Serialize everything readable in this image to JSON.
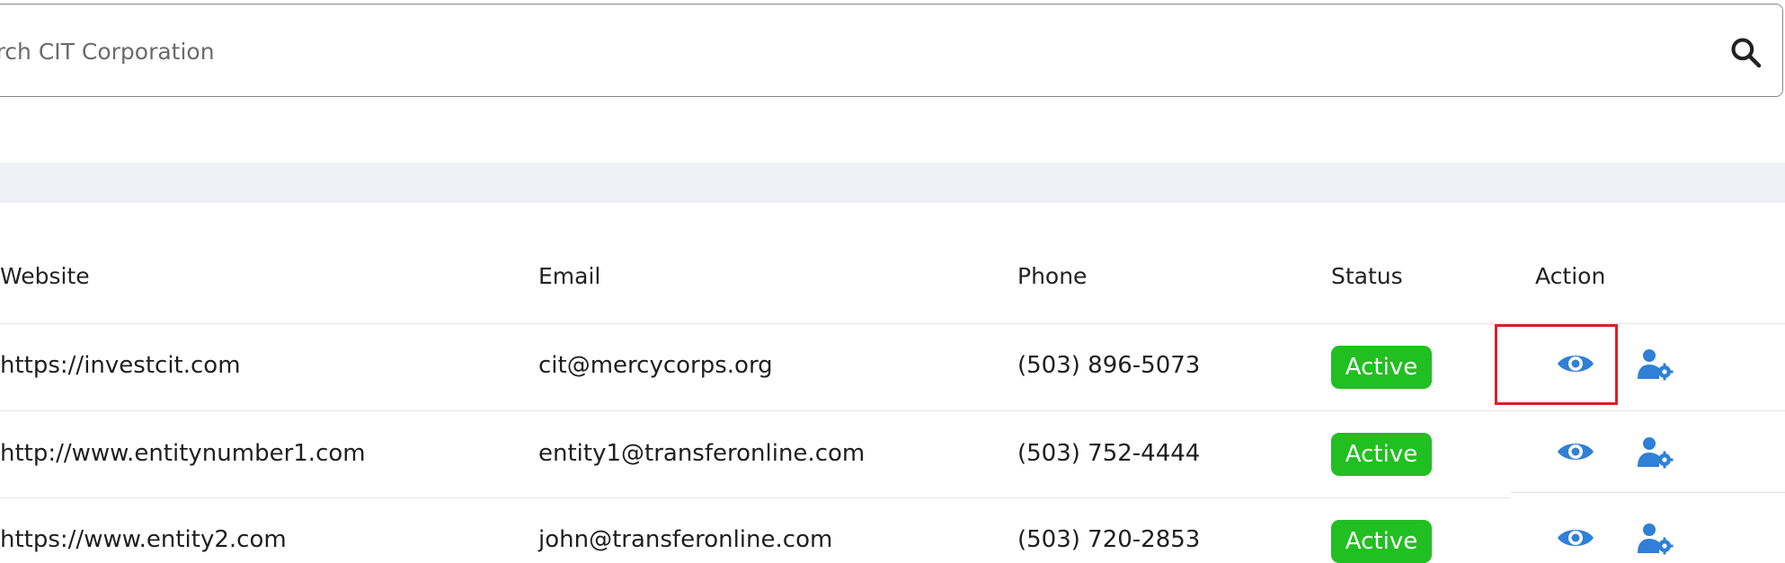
{
  "search": {
    "placeholder": "Search CIT Corporation"
  },
  "table": {
    "headers": [
      "Website",
      "Email",
      "Phone",
      "Status",
      "Action"
    ],
    "rows": [
      {
        "website": "https://investcit.com",
        "email": "cit@mercycorps.org",
        "phone": "(503) 896-5073",
        "status": "Active"
      },
      {
        "website": "http://www.entitynumber1.com",
        "email": "entity1@transferonline.com",
        "phone": "(503) 752-4444",
        "status": "Active"
      },
      {
        "website": "https://www.entity2.com",
        "email": "john@transferonline.com",
        "phone": "(503) 720-2853",
        "status": "Active"
      }
    ]
  },
  "icons": {
    "search": "search-icon",
    "view": "eye-icon",
    "manage": "user-gear-icon"
  },
  "colors": {
    "status_active": "#21bf21",
    "action_icon": "#2f80d6",
    "highlight": "#d6212a",
    "band": "#edf1f6"
  }
}
